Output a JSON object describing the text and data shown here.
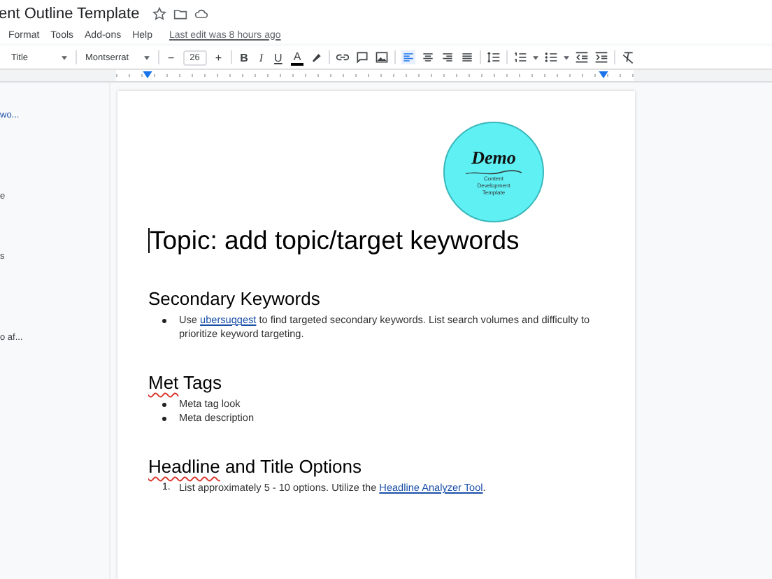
{
  "document": {
    "title": "ent Outline Template",
    "last_edit": "Last edit was 8 hours ago"
  },
  "menu": [
    "Format",
    "Tools",
    "Add-ons",
    "Help"
  ],
  "toolbar": {
    "style": "Title",
    "font": "Montserrat",
    "minus": "−",
    "size": "26",
    "plus": "+",
    "bold": "B",
    "italic": "I",
    "underline": "U",
    "text_color": "A"
  },
  "outline": [
    {
      "text": "wo...",
      "selected": true
    },
    {
      "text": "e",
      "selected": false
    },
    {
      "text": "s",
      "selected": false
    },
    {
      "text": "o af...",
      "selected": false
    }
  ],
  "logo": {
    "title": "Demo",
    "subtitle": "Content Development Template"
  },
  "content": [
    {
      "kind": "title",
      "parts": [
        {
          "text": "Topic: add topic/target keywords",
          "misspelled": false
        }
      ]
    },
    {
      "kind": "heading",
      "parts": [
        {
          "text": "Secondary Keywords",
          "misspelled": false
        }
      ]
    },
    {
      "kind": "bullets",
      "items": [
        [
          {
            "text": "Use ",
            "kind": "plain"
          },
          {
            "text": "ubersuggest",
            "kind": "link"
          },
          {
            "text": " to find targeted secondary keywords. List search volumes and difficulty to prioritize keyword targeting.",
            "kind": "plain"
          }
        ]
      ]
    },
    {
      "kind": "heading",
      "parts": [
        {
          "text": "Met",
          "misspelled": true
        },
        {
          "text": " Tags",
          "misspelled": false
        }
      ]
    },
    {
      "kind": "bullets",
      "items": [
        [
          {
            "text": "Meta tag look",
            "kind": "plain"
          }
        ],
        [
          {
            "text": "Meta description",
            "kind": "plain"
          }
        ]
      ]
    },
    {
      "kind": "heading",
      "parts": [
        {
          "text": "Headline",
          "misspelled": true
        },
        {
          "text": " and Title Options",
          "misspelled": false
        }
      ]
    },
    {
      "kind": "numbered",
      "numbers": [
        "1."
      ],
      "items": [
        [
          {
            "text": "List approximately 5 - 10 options. Utilize the ",
            "kind": "plain"
          },
          {
            "text": "Headline Analyzer Tool",
            "kind": "link"
          },
          {
            "text": ".",
            "kind": "plain"
          }
        ]
      ]
    }
  ]
}
